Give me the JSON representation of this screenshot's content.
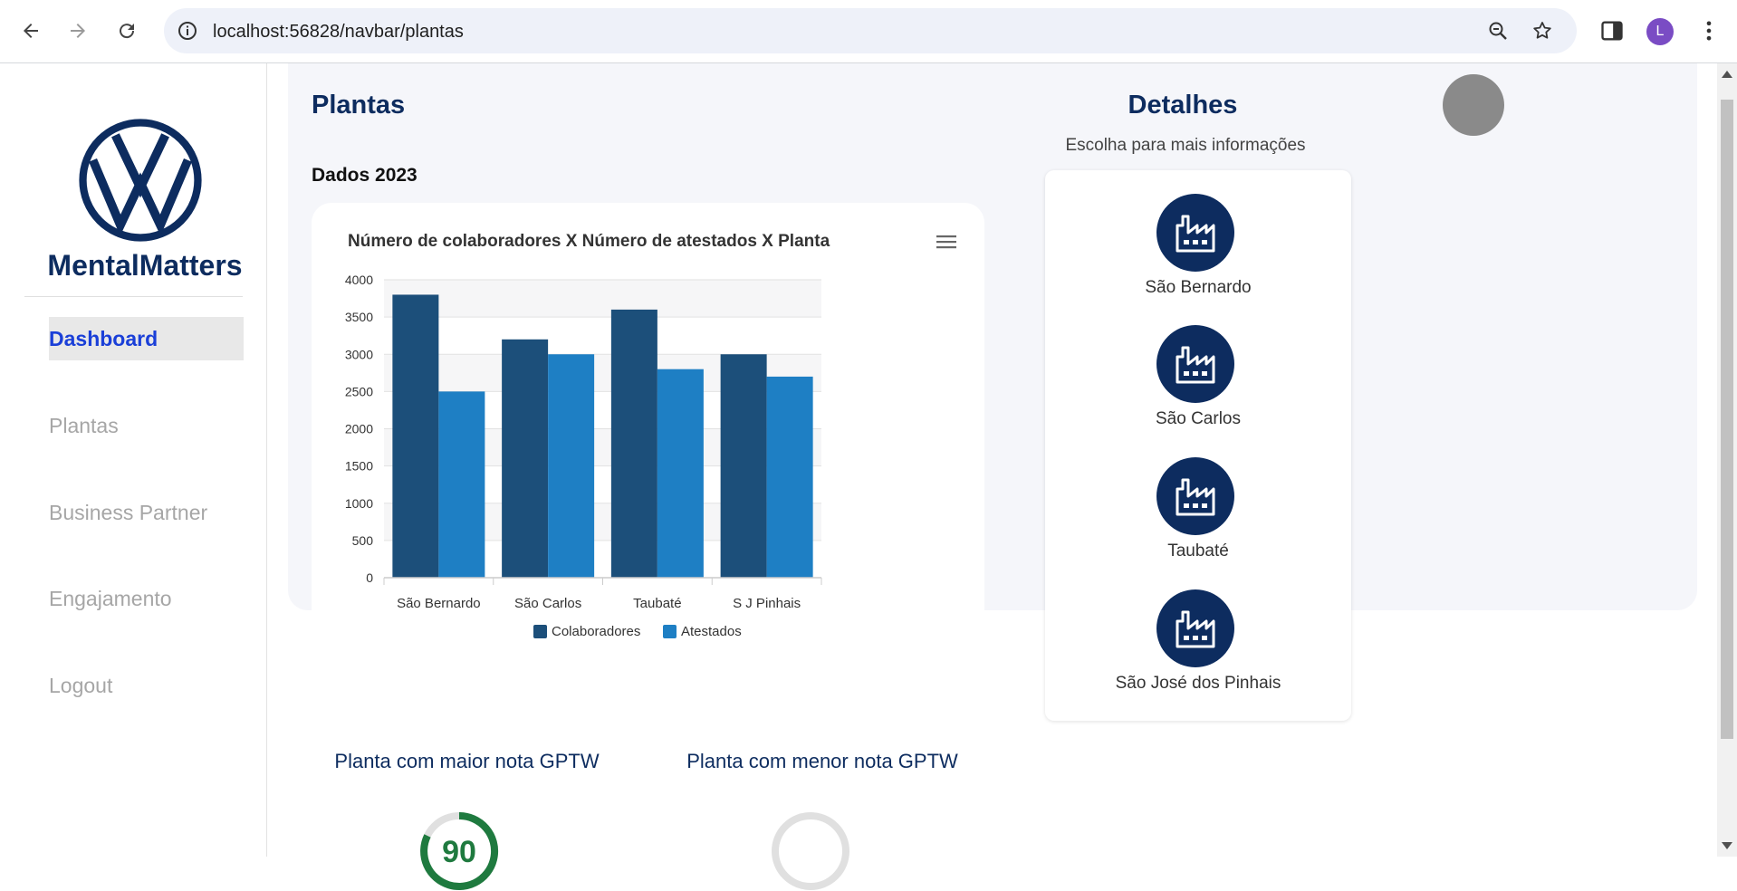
{
  "browser": {
    "url": "localhost:56828/navbar/plantas",
    "avatar_letter": "L"
  },
  "sidebar": {
    "brand": "MentalMatters",
    "items": [
      {
        "label": "Dashboard",
        "active": true
      },
      {
        "label": "Plantas",
        "active": false
      },
      {
        "label": "Business Partner",
        "active": false
      },
      {
        "label": "Engajamento",
        "active": false
      },
      {
        "label": "Logout",
        "active": false
      }
    ]
  },
  "main": {
    "title": "Plantas",
    "subtitle": "Dados 2023",
    "gptw": {
      "highest_title": "Planta com maior nota GPTW",
      "highest_value": "90",
      "lowest_title": "Planta com menor nota GPTW"
    }
  },
  "details": {
    "title": "Detalhes",
    "subtitle": "Escolha para mais informações",
    "plants": [
      "São Bernardo",
      "São Carlos",
      "Taubaté",
      "São José dos Pinhais"
    ]
  },
  "colors": {
    "brand_navy": "#0d2c5f",
    "colaboradores": "#1c4f7a",
    "atestados": "#1e7fc4",
    "active_link": "#1a3fd8",
    "gauge_green": "#1f7a3f"
  },
  "chart_data": {
    "type": "bar",
    "title": "Número de colaboradores X Número de atestados X Planta",
    "categories": [
      "São Bernardo",
      "São Carlos",
      "Taubaté",
      "S J Pinhais"
    ],
    "series": [
      {
        "name": "Colaboradores",
        "values": [
          3800,
          3200,
          3600,
          3000
        ]
      },
      {
        "name": "Atestados",
        "values": [
          2500,
          3000,
          2800,
          2700
        ]
      }
    ],
    "ylim": [
      0,
      4000
    ],
    "yticks": [
      "4000",
      "3500",
      "3000",
      "2500",
      "2000",
      "1500",
      "1000",
      "500",
      "0"
    ],
    "legend": "bottom",
    "grid": true
  }
}
